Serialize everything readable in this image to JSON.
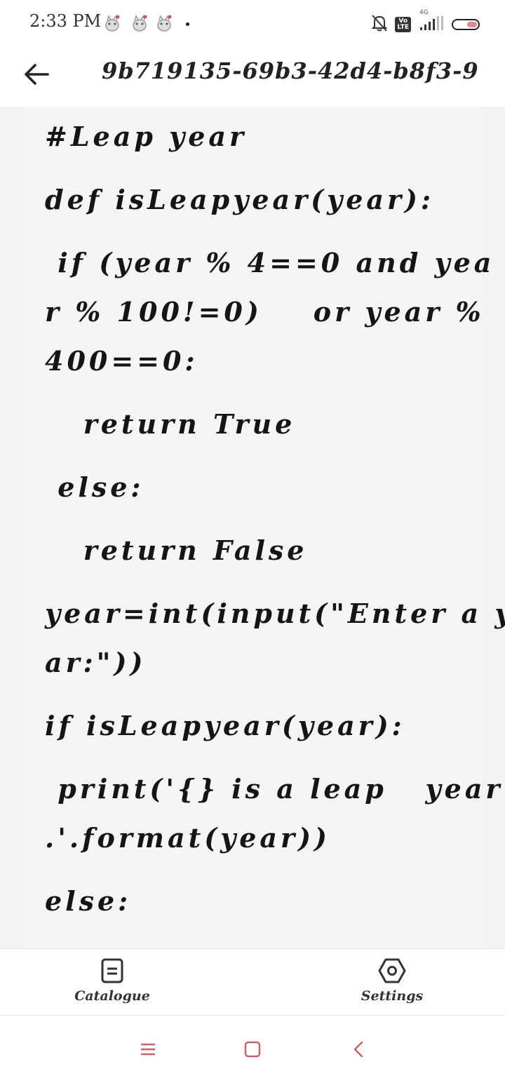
{
  "status_bar": {
    "time": "2:33 PM",
    "notification_icons": [
      "cat-icon",
      "cat-icon",
      "cat-icon"
    ],
    "network_label": "4G",
    "volte_label": "Vo\nLTE",
    "battery_level": 0.45,
    "battery_color": "#d98b93"
  },
  "header": {
    "title": "9b719135-69b3-42d4-b8f3-9..."
  },
  "code_lines": [
    "#Leap year",
    "def isLeapyear(year):",
    " if (year % 4==0 and yea",
    "r % 100!=0)    or year %",
    "400==0:",
    "   return True",
    " else:",
    "   return False",
    "year=int(input(\"Enter a ye",
    "ar:\"))",
    "if isLeapyear(year):",
    " print('{} is a leap   year",
    ".'.format(year))",
    "else:"
  ],
  "bottom_nav": {
    "catalogue_label": "Catalogue",
    "settings_label": "Settings"
  },
  "colors": {
    "accent": "#c0656e",
    "content_bg": "#f5f5f5"
  }
}
